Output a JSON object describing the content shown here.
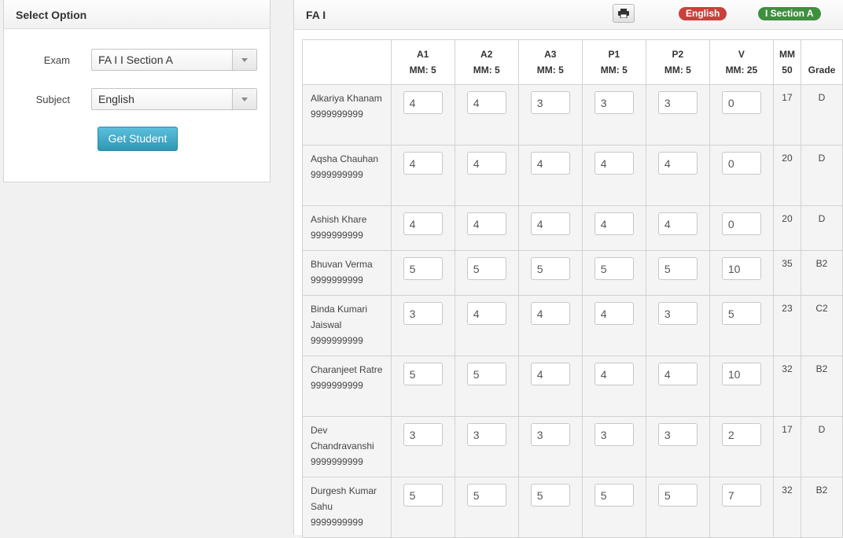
{
  "left": {
    "title": "Select Option",
    "exam_label": "Exam",
    "exam_value": "FA I I Section A",
    "subject_label": "Subject",
    "subject_value": "English",
    "button_label": "Get Student"
  },
  "right": {
    "title": "FA I",
    "print_icon": "print-icon",
    "badges": {
      "subject": "English",
      "class": "I Section A"
    },
    "colors": {
      "subject_badge": "#c9413c",
      "class_badge": "#3f8f3f",
      "button": "#39a3c6"
    }
  },
  "table": {
    "headers": [
      {
        "top": "A1",
        "bottom": "MM: 5"
      },
      {
        "top": "A2",
        "bottom": "MM: 5"
      },
      {
        "top": "A3",
        "bottom": "MM: 5"
      },
      {
        "top": "P1",
        "bottom": "MM: 5"
      },
      {
        "top": "P2",
        "bottom": "MM: 5"
      },
      {
        "top": "V",
        "bottom": "MM: 25"
      },
      {
        "top": "MM",
        "bottom": "50"
      },
      {
        "top": "",
        "bottom": "Grade"
      }
    ],
    "rows": [
      {
        "name": "Alkariya Khanam",
        "phone": "9999999999",
        "marks": [
          "4",
          "4",
          "3",
          "3",
          "3",
          "0"
        ],
        "total": "17",
        "grade": "D"
      },
      {
        "name": "Aqsha Chauhan",
        "phone": "9999999999",
        "marks": [
          "4",
          "4",
          "4",
          "4",
          "4",
          "0"
        ],
        "total": "20",
        "grade": "D"
      },
      {
        "name": "Ashish Khare",
        "phone": "9999999999",
        "marks": [
          "4",
          "4",
          "4",
          "4",
          "4",
          "0"
        ],
        "total": "20",
        "grade": "D"
      },
      {
        "name": "Bhuvan Verma",
        "phone": "9999999999",
        "marks": [
          "5",
          "5",
          "5",
          "5",
          "5",
          "10"
        ],
        "total": "35",
        "grade": "B2"
      },
      {
        "name": "Binda Kumari Jaiswal",
        "phone": "9999999999",
        "marks": [
          "3",
          "4",
          "4",
          "4",
          "3",
          "5"
        ],
        "total": "23",
        "grade": "C2"
      },
      {
        "name": "Charanjeet Ratre",
        "phone": "9999999999",
        "marks": [
          "5",
          "5",
          "4",
          "4",
          "4",
          "10"
        ],
        "total": "32",
        "grade": "B2"
      },
      {
        "name": "Dev Chandravanshi",
        "phone": "9999999999",
        "marks": [
          "3",
          "3",
          "3",
          "3",
          "3",
          "2"
        ],
        "total": "17",
        "grade": "D"
      },
      {
        "name": "Durgesh Kumar Sahu",
        "phone": "9999999999",
        "marks": [
          "5",
          "5",
          "5",
          "5",
          "5",
          "7"
        ],
        "total": "32",
        "grade": "B2"
      }
    ]
  }
}
